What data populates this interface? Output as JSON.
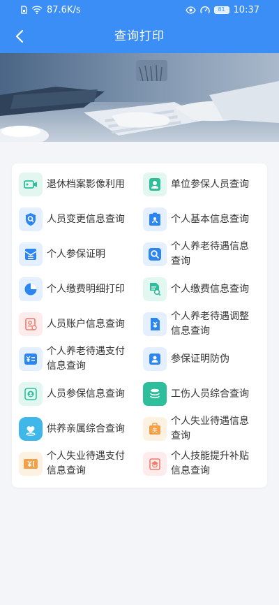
{
  "status_bar": {
    "net_speed": "87.6K/s",
    "battery": "81",
    "time": "10:37"
  },
  "nav": {
    "title": "查询打印"
  },
  "colors": {
    "header": "#3a8ef6",
    "teal": "#2dbf9c",
    "blue": "#2c86f0",
    "orange": "#f3a048",
    "red": "#ef7a6b",
    "background": "#f3f5f8"
  },
  "menu": {
    "items": [
      {
        "label": "退休档案影像利用",
        "icon": "video-icon"
      },
      {
        "label": "单位参保人员查询",
        "icon": "person-card-icon"
      },
      {
        "label": "人员变更信息查询",
        "icon": "shield-search-icon"
      },
      {
        "label": "个人基本信息查询",
        "icon": "clipboard-person-icon"
      },
      {
        "label": "个人参保证明",
        "icon": "certificate-icon"
      },
      {
        "label": "个人养老待遇信息查询",
        "icon": "search-icon"
      },
      {
        "label": "个人缴费明细打印",
        "icon": "pie-chart-icon"
      },
      {
        "label": "个人缴费信息查询",
        "icon": "document-search-icon"
      },
      {
        "label": "人员账户信息查询",
        "icon": "account-document-icon"
      },
      {
        "label": "个人养老待遇调整信息查询",
        "icon": "yen-document-icon"
      },
      {
        "label": "个人养老待遇支付信息查询",
        "icon": "yen-list-icon"
      },
      {
        "label": "参保证明防伪",
        "icon": "person-shield-icon"
      },
      {
        "label": "人员参保信息查询",
        "icon": "person-badge-icon"
      },
      {
        "label": "工伤人员综合查询",
        "icon": "coins-stack-icon"
      },
      {
        "label": "供养亲属综合查询",
        "icon": "heart-map-icon"
      },
      {
        "label": "个人失业待遇信息查询",
        "icon": "unemployment-briefcase-icon"
      },
      {
        "label": "个人失业待遇支付信息查询",
        "icon": "yen-ticket-icon"
      },
      {
        "label": "个人技能提升补贴信息查询",
        "icon": "graduation-cap-icon"
      }
    ]
  }
}
